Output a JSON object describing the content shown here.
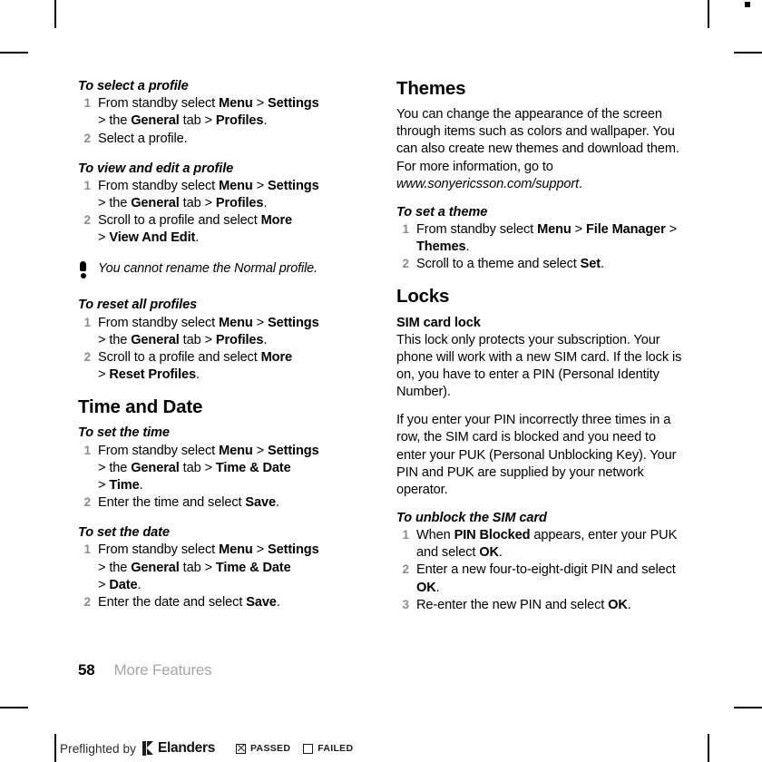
{
  "page": {
    "number": "58",
    "chapter": "More Features"
  },
  "left_column": {
    "proc_select_profile": {
      "heading": "To select a profile",
      "steps": [
        {
          "line1_prefix": "From standby select ",
          "b1": "Menu",
          "mid1": " > ",
          "b2": "Settings",
          "line2_prefix": "> the ",
          "b3": "General",
          "mid2": " tab > ",
          "b4": "Profiles",
          "end": "."
        },
        {
          "text": "Select a profile."
        }
      ]
    },
    "proc_view_edit_profile": {
      "heading": "To view and edit a profile",
      "steps": [
        {
          "line1_prefix": "From standby select ",
          "b1": "Menu",
          "mid1": " > ",
          "b2": "Settings",
          "line2_prefix": "> the ",
          "b3": "General",
          "mid2": " tab > ",
          "b4": "Profiles",
          "end": "."
        },
        {
          "line1_prefix": "Scroll to a profile and select ",
          "b1": "More",
          "line2_prefix": "> ",
          "b2": "View And Edit",
          "end": "."
        }
      ]
    },
    "note": "You cannot rename the Normal profile.",
    "proc_reset_profiles": {
      "heading": "To reset all profiles",
      "steps": [
        {
          "line1_prefix": "From standby select ",
          "b1": "Menu",
          "mid1": " > ",
          "b2": "Settings",
          "line2_prefix": "> the ",
          "b3": "General",
          "mid2": " tab > ",
          "b4": "Profiles",
          "end": "."
        },
        {
          "line1_prefix": "Scroll to a profile and select ",
          "b1": "More",
          "line2_prefix": "> ",
          "b2": "Reset Profiles",
          "end": "."
        }
      ]
    },
    "section_time_and_date": "Time and Date",
    "proc_set_time": {
      "heading": "To set the time",
      "steps": [
        {
          "line1_prefix": "From standby select ",
          "b1": "Menu",
          "mid1": " > ",
          "b2": "Settings",
          "line2_prefix": "> the ",
          "b3": "General",
          "mid2": " tab > ",
          "b4": "Time & Date",
          "line3_prefix": "> ",
          "b5": "Time",
          "end": "."
        },
        {
          "text_prefix": "Enter the time and select ",
          "b1": "Save",
          "end": "."
        }
      ]
    },
    "proc_set_date": {
      "heading": "To set the date",
      "steps": [
        {
          "line1_prefix": "From standby select ",
          "b1": "Menu",
          "mid1": " > ",
          "b2": "Settings",
          "line2_prefix": "> the ",
          "b3": "General",
          "mid2": " tab > ",
          "b4": "Time & Date",
          "line3_prefix": "> ",
          "b5": "Date",
          "end": "."
        },
        {
          "text_prefix": "Enter the date and select ",
          "b1": "Save",
          "end": "."
        }
      ]
    }
  },
  "right_column": {
    "section_themes": "Themes",
    "themes_body_part1": "You can change the appearance of the screen through items such as colors and wallpaper. You can also create new themes and download them. For more information, go to ",
    "themes_url": "www.sonyericsson.com/support",
    "themes_body_end": ".",
    "proc_set_theme": {
      "heading": "To set a theme",
      "steps": [
        {
          "line1_prefix": "From standby select ",
          "b1": "Menu",
          "mid1": " > ",
          "b2": "File Manager",
          "mid2": " > ",
          "b3": "Themes",
          "end": "."
        },
        {
          "text_prefix": "Scroll to a theme and select ",
          "b1": "Set",
          "end": "."
        }
      ]
    },
    "section_locks": "Locks",
    "subhead_sim_card_lock": "SIM card lock",
    "sim_body_1": "This lock only protects your subscription. Your phone will work with a new SIM card. If the lock is on, you have to enter a PIN (Personal Identity Number).",
    "sim_body_2": "If you enter your PIN incorrectly three times in a row, the SIM card is blocked and you need to enter your PUK (Personal Unblocking Key). Your PIN and PUK are supplied by your network operator.",
    "proc_unblock_sim": {
      "heading": "To unblock the SIM card",
      "steps": [
        {
          "line1_prefix": "When ",
          "b1": "PIN Blocked",
          "mid1": " appears, enter your PUK and select ",
          "b2": "OK",
          "end": "."
        },
        {
          "line1_prefix": "Enter a new four-to-eight-digit PIN and select ",
          "b1": "OK",
          "end": "."
        },
        {
          "line1_prefix": "Re-enter the new PIN and select ",
          "b1": "OK",
          "end": "."
        }
      ]
    }
  },
  "preflight": {
    "label": "Preflighted by",
    "brand": "Elanders",
    "passed_label": "PASSED",
    "failed_label": "FAILED",
    "passed_checked": true,
    "failed_checked": false
  },
  "colors": {
    "text": "#000000",
    "step_number": "#8c8c8c",
    "chapter_gray": "#a6a6a6",
    "mark": "#000000"
  }
}
